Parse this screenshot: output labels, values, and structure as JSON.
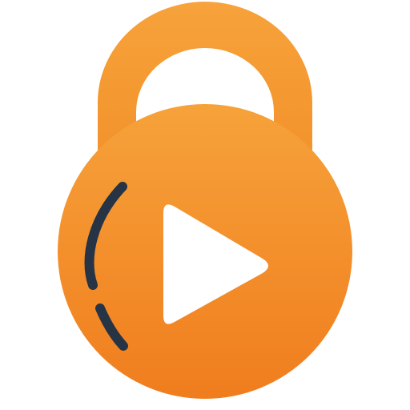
{
  "icon": {
    "name": "lock-play-icon",
    "description_semantic": "padlock-with-play-button",
    "colors": {
      "lock_gradient_top": "#f6a23a",
      "lock_gradient_bottom": "#f07d1e",
      "shackle": "#f4952e",
      "play_triangle": "#ffffff",
      "dashed_arc": "#263445",
      "background": "#ffffff"
    }
  }
}
